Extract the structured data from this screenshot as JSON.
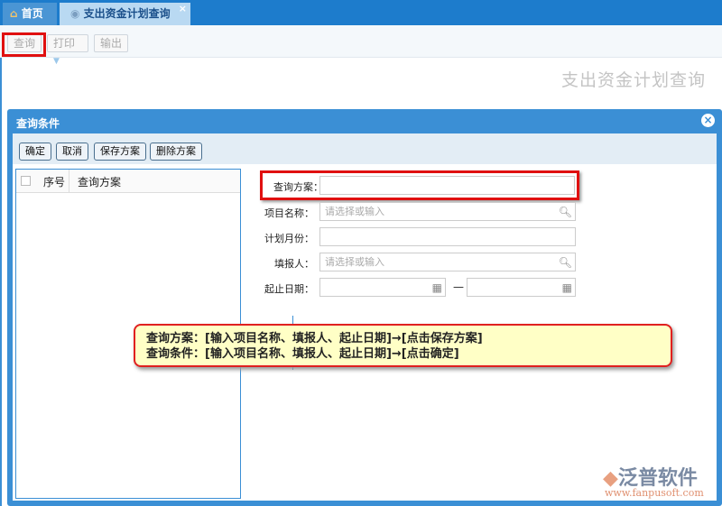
{
  "tabs": [
    {
      "label": "首页",
      "icon": "home-icon"
    },
    {
      "label": "支出资金计划查询",
      "icon": "circle-icon"
    }
  ],
  "toolbar": {
    "query": "查询",
    "print": "打印",
    "export": "输出"
  },
  "page_title": "支出资金计划查询",
  "dialog": {
    "title": "查询条件",
    "buttons": {
      "ok": "确定",
      "cancel": "取消",
      "save": "保存方案",
      "delete": "删除方案"
    },
    "table_headers": {
      "index": "序号",
      "scheme": "查询方案"
    },
    "form": {
      "scheme_label": "查询方案：",
      "scheme_value": "",
      "project_label": "项目名称：",
      "project_placeholder": "请选择或输入",
      "month_label": "计划月份：",
      "month_value": "",
      "reporter_label": "填报人：",
      "reporter_placeholder": "请选择或输入",
      "date_label": "起止日期：",
      "date_sep": "—"
    }
  },
  "note": {
    "line1": "查询方案：[输入项目名称、填报人、起止日期]→[点击保存方案]",
    "line2": "查询条件：[输入项目名称、填报人、起止日期]→[点击确定]"
  },
  "logo": {
    "name": "泛普软件",
    "url": "www.fanpusoft.com"
  }
}
